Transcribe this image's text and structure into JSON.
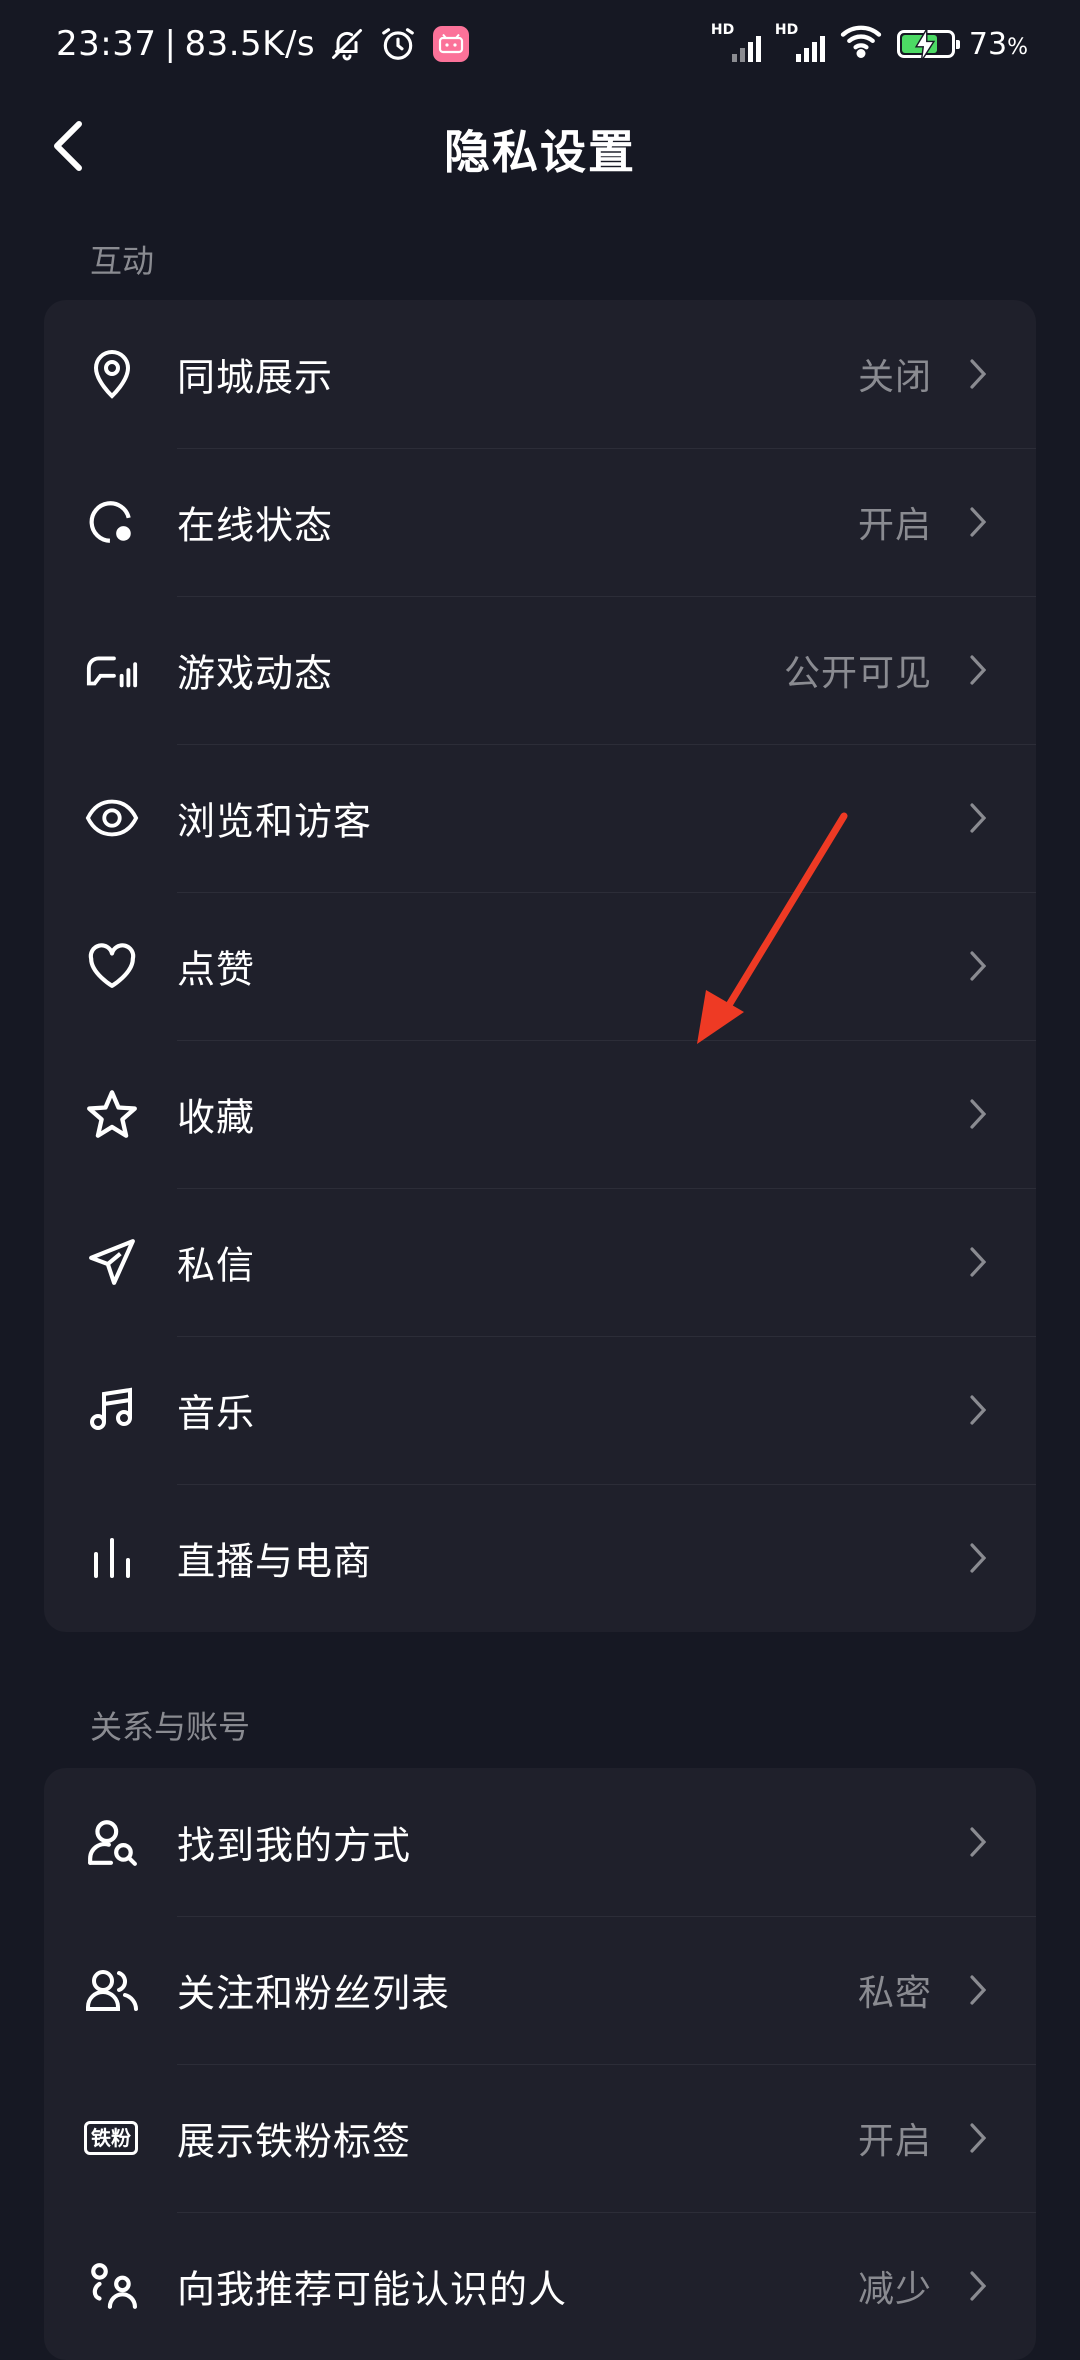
{
  "status_bar": {
    "time": "23:37",
    "net_speed": "83.5K/s",
    "separator": "|",
    "hd1": "HD",
    "hd2": "HD",
    "battery_percent": "73",
    "battery_unit": "%",
    "battery_level": 0.73,
    "battery_color": "#4cd964",
    "app_badge_color": "#fb7299",
    "icons": [
      "bell-off-icon",
      "alarm-icon",
      "bilibili-icon",
      "signal-icon",
      "wifi-icon",
      "battery-charging-icon"
    ]
  },
  "header": {
    "title": "隐私设置",
    "back_icon": "chevron-left-icon"
  },
  "sections": [
    {
      "label": "互动",
      "items": [
        {
          "icon": "location-pin-icon",
          "label": "同城展示",
          "value": "关闭"
        },
        {
          "icon": "online-status-icon",
          "label": "在线状态",
          "value": "开启"
        },
        {
          "icon": "game-controller-icon",
          "label": "游戏动态",
          "value": "公开可见"
        },
        {
          "icon": "eye-icon",
          "label": "浏览和访客",
          "value": ""
        },
        {
          "icon": "heart-icon",
          "label": "点赞",
          "value": ""
        },
        {
          "icon": "star-icon",
          "label": "收藏",
          "value": ""
        },
        {
          "icon": "paper-plane-icon",
          "label": "私信",
          "value": ""
        },
        {
          "icon": "music-note-icon",
          "label": "音乐",
          "value": ""
        },
        {
          "icon": "live-bars-icon",
          "label": "直播与电商",
          "value": ""
        }
      ]
    },
    {
      "label": "关系与账号",
      "items": [
        {
          "icon": "user-search-icon",
          "label": "找到我的方式",
          "value": ""
        },
        {
          "icon": "users-icon",
          "label": "关注和粉丝列表",
          "value": "私密"
        },
        {
          "icon": "iron-fan-badge-icon",
          "badge_text": "铁粉",
          "label": "展示铁粉标签",
          "value": "开启"
        },
        {
          "icon": "recommend-people-icon",
          "label": "向我推荐可能认识的人",
          "value": "减少"
        }
      ]
    }
  ],
  "annotation": {
    "icon": "red-arrow-annotation",
    "color": "#ee3a24"
  },
  "colors": {
    "background": "#161823",
    "card": "#1f202b",
    "secondary_text": "#8a8b91"
  }
}
